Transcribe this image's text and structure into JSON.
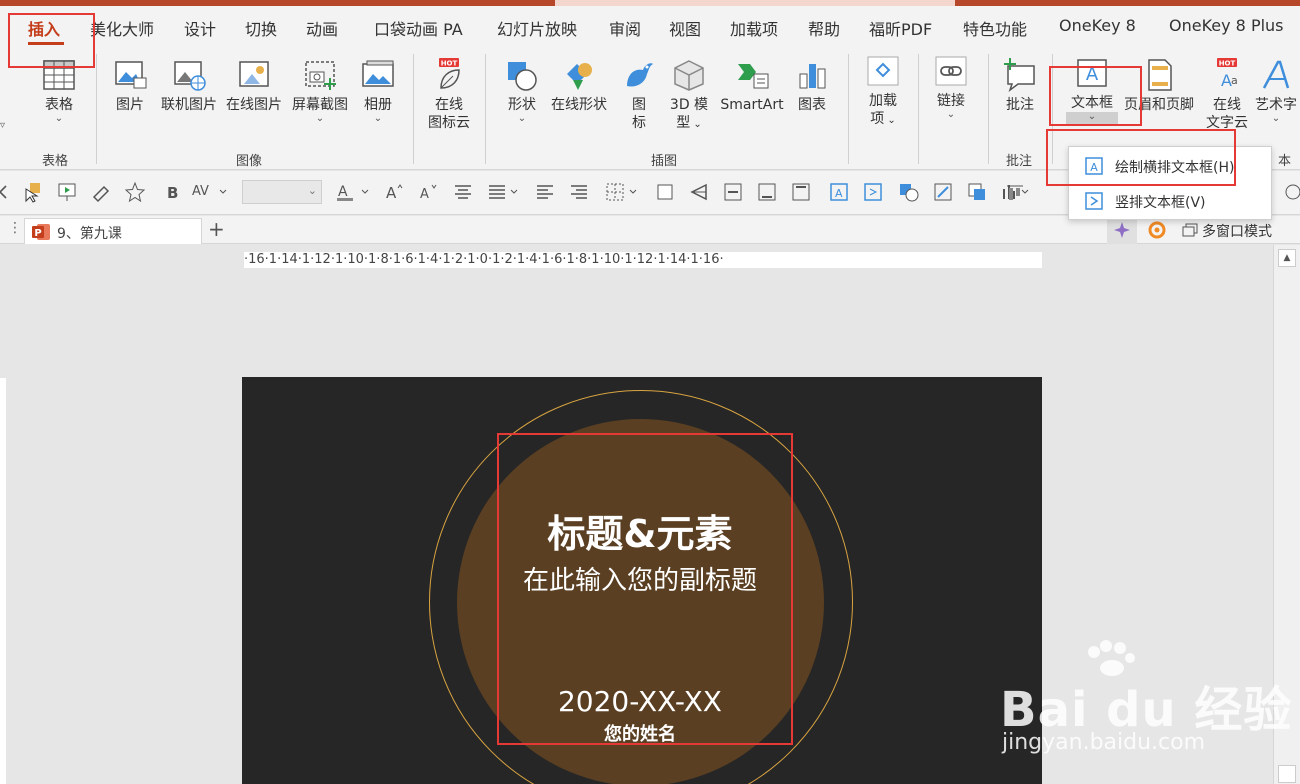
{
  "tabs": [
    "插入",
    "美化大师",
    "设计",
    "切换",
    "动画",
    "口袋动画 PA",
    "幻灯片放映",
    "审阅",
    "视图",
    "加载项",
    "帮助",
    "福昕PDF",
    "特色功能",
    "OneKey 8",
    "OneKey 8 Plus"
  ],
  "ribbon": {
    "table": {
      "label": "表格",
      "group": "表格"
    },
    "image_group": "图像",
    "images": [
      "图片",
      "联机图片",
      "在线图片",
      "屏幕截图",
      "相册"
    ],
    "online_icon": {
      "line1": "在线",
      "line2": "图标云",
      "badge": "HOT"
    },
    "illus_group": "插图",
    "shape": "形状",
    "online_shape": "在线形状",
    "icon": {
      "line1": "图",
      "line2": "标"
    },
    "model3d": {
      "line1": "3D 模",
      "line2": "型"
    },
    "smartart": "SmartArt",
    "chart": "图表",
    "addin": {
      "line1": "加载",
      "line2": "项"
    },
    "link": "链接",
    "comment": "批注",
    "comment_group": "批注",
    "textbox": "文本框",
    "header_footer": "页眉和页脚",
    "online_text": {
      "line1": "在线",
      "line2": "文字云",
      "badge": "HOT"
    },
    "art_text": "艺术字",
    "text_group_partial": "本"
  },
  "dropdown": {
    "horizontal": "绘制横排文本框(H)",
    "vertical": "竖排文本框(V)"
  },
  "doc_tab": "9、第九课",
  "multi_window": "多窗口模式",
  "ruler_text": "·16·1·14·1·12·1·10·1·8·1·6·1·4·1·2·1·0·1·2·1·4·1·6·1·8·1·10·1·12·1·14·1·16·",
  "slide": {
    "title": "标题&元素",
    "subtitle": "在此输入您的副标题",
    "date": "2020-XX-XX",
    "name": "您的姓名"
  },
  "watermark": {
    "brand": "Bai du 经验",
    "url": "jingyan.baidu.com"
  },
  "colors": {
    "accent": "#c43e1c",
    "highlight": "#e53935",
    "slide_bg": "#262626",
    "circle": "#5a3f22",
    "ring": "#d9a441"
  }
}
